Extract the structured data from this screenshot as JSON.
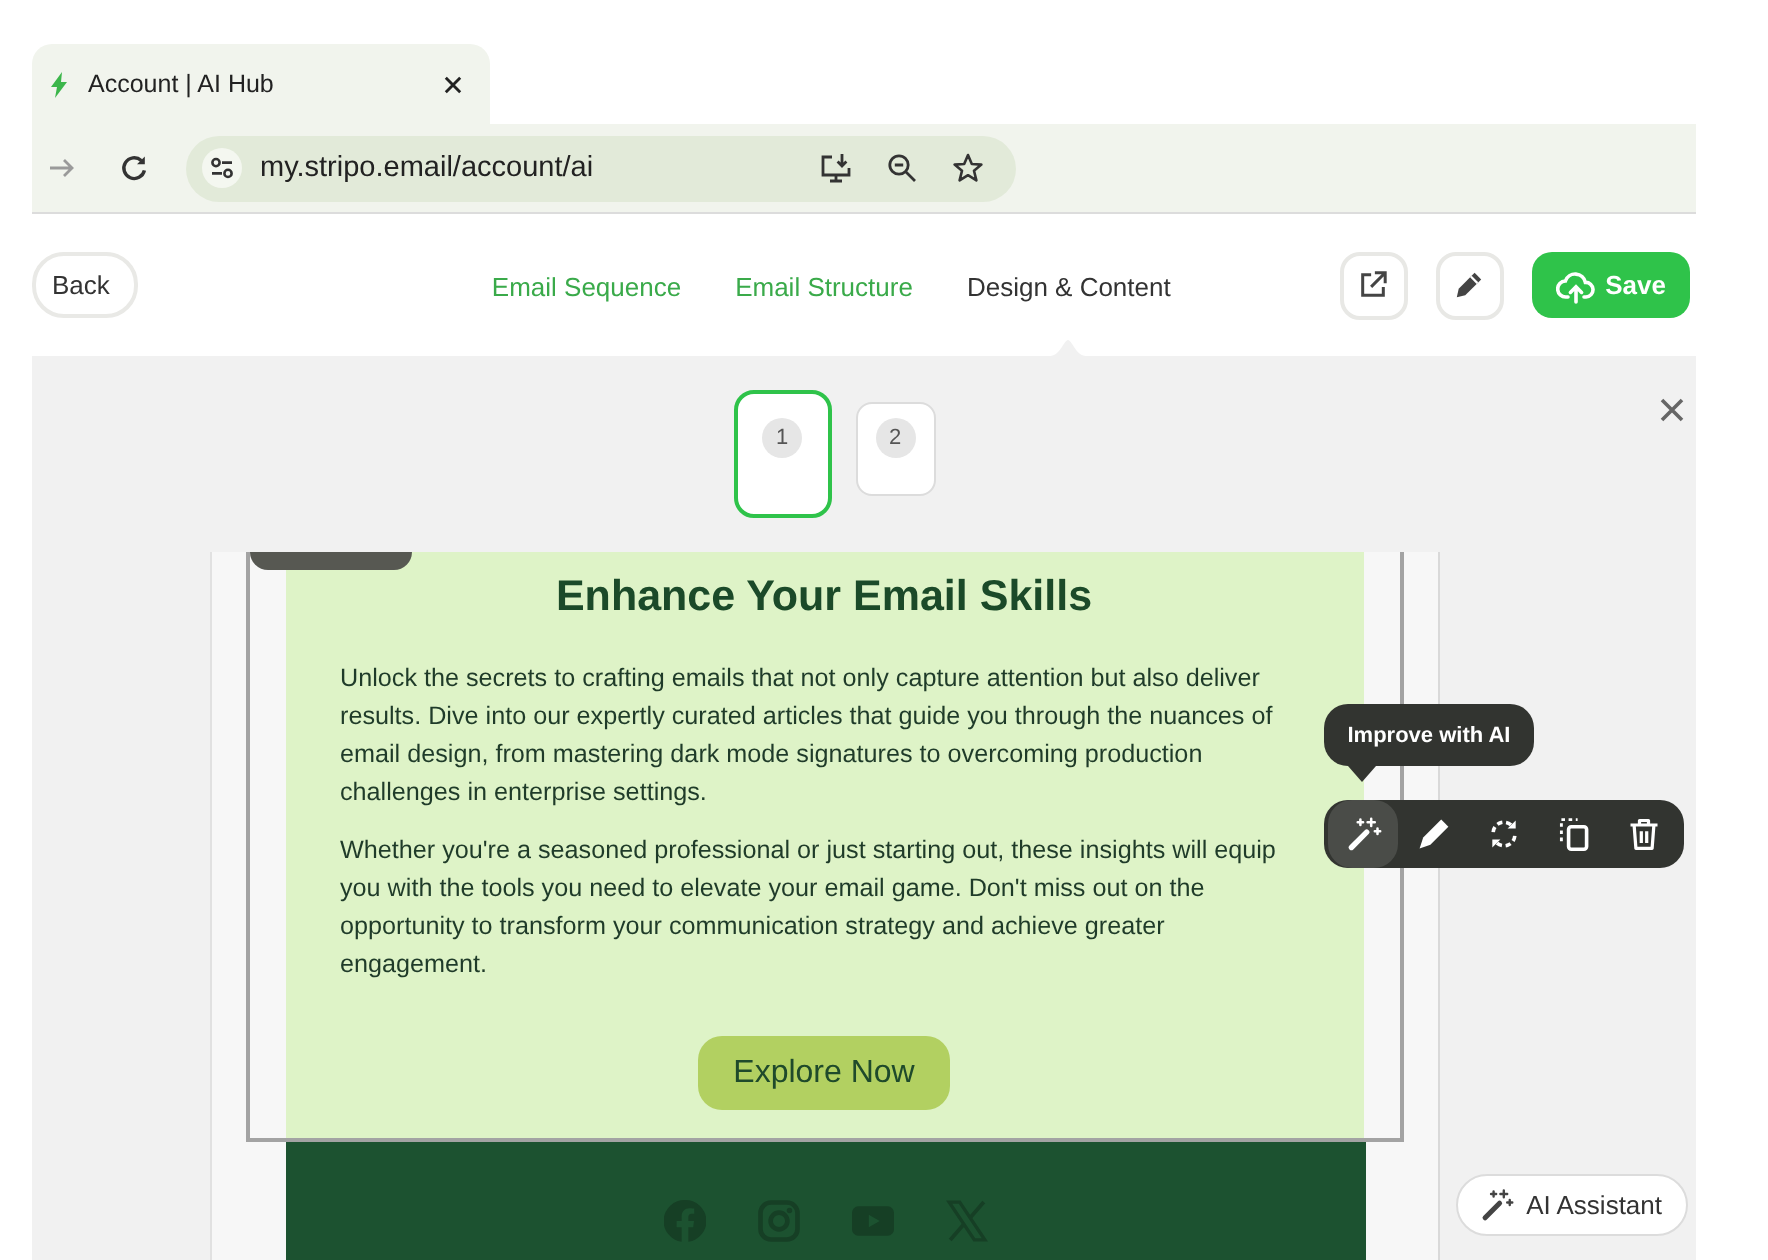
{
  "browser": {
    "tab_title": "Account | AI Hub",
    "url": "my.stripo.email/account/ai"
  },
  "header": {
    "back": "Back",
    "tabs": [
      {
        "label": "Email Sequence",
        "selected": false
      },
      {
        "label": "Email Structure",
        "selected": false
      },
      {
        "label": "Design & Content",
        "selected": true
      }
    ],
    "save": "Save"
  },
  "pages": [
    {
      "label": "1",
      "selected": true
    },
    {
      "label": "2",
      "selected": false
    }
  ],
  "email": {
    "heading": "Enhance Your Email Skills",
    "paragraphs": [
      "Unlock the secrets to crafting emails that not only capture attention but also deliver results. Dive into our expertly curated articles that guide you through the nuances of email design, from mastering dark mode signatures to overcoming production challenges in enterprise settings.",
      "Whether you're a seasoned professional or just starting out, these insights will equip you with the tools you need to elevate your email game. Don't miss out on the opportunity to transform your communication strategy and achieve greater engagement."
    ],
    "button": "Explore Now"
  },
  "block_toolbar": {
    "tooltip": "Improve with AI",
    "tools": [
      {
        "kind": "wand",
        "hovered": true
      },
      {
        "kind": "pencil",
        "hovered": false
      },
      {
        "kind": "refresh",
        "hovered": false
      },
      {
        "kind": "duplicate",
        "hovered": false
      },
      {
        "kind": "trash",
        "hovered": false
      }
    ]
  },
  "ai_assistant": "AI Assistant"
}
